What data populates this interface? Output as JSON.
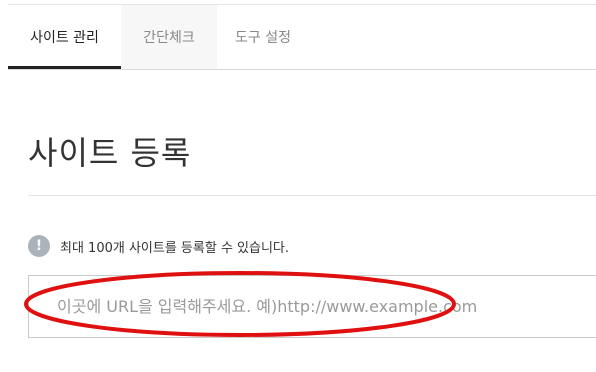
{
  "tabs": [
    {
      "label": "사이트 관리",
      "active": true
    },
    {
      "label": "간단체크",
      "active": false
    },
    {
      "label": "도구 설정",
      "active": false
    }
  ],
  "main": {
    "title": "사이트 등록",
    "notice": "최대 100개 사이트를 등록할 수 있습니다.",
    "info_icon": "exclamation-circle-icon",
    "url_input": {
      "placeholder": "이곳에 URL을 입력해주세요. 예)http://www.example.com",
      "value": ""
    }
  },
  "annotation": {
    "shape": "ellipse",
    "color": "#e01010"
  },
  "colors": {
    "active_tab_underline": "#222222",
    "info_icon": "#aab2ba"
  }
}
